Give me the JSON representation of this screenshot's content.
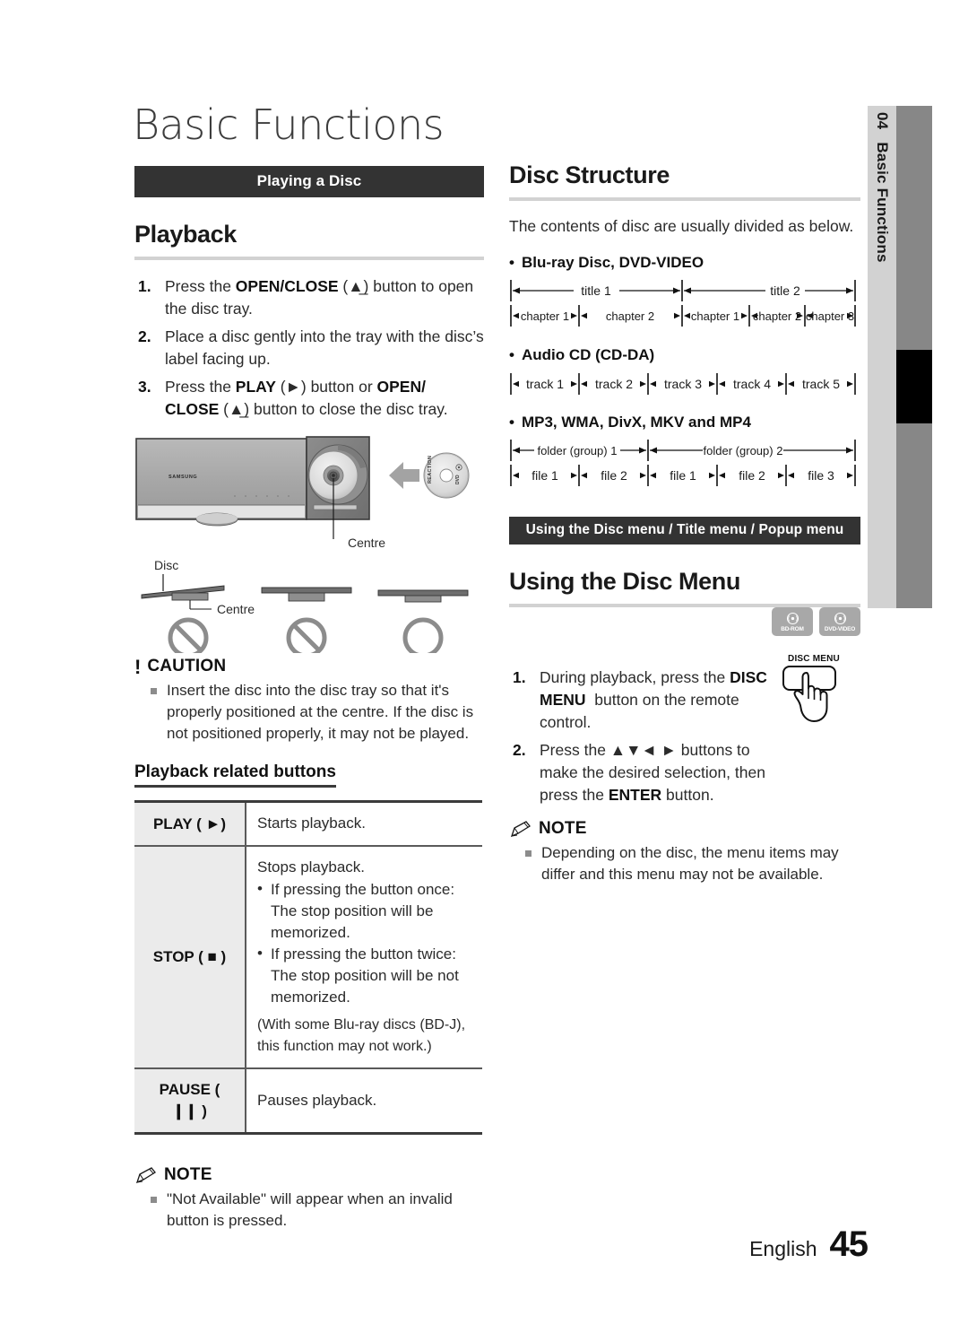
{
  "page": {
    "chapter_number": "04",
    "chapter_name": "Basic Functions",
    "title": "Basic Functions",
    "footer_language": "English",
    "footer_page": "45"
  },
  "left_column": {
    "banner": "Playing a Disc",
    "heading": "Playback",
    "steps": [
      {
        "num": "1.",
        "html": "Press the <b>OPEN/CLOSE</b> (&#9650;&#818;) button to open the disc tray."
      },
      {
        "num": "2.",
        "html": "Place a disc gently into the tray with the disc’s label facing up."
      },
      {
        "num": "3.",
        "html": "Press the <b>PLAY</b> (&#9658;) button or <b>OPEN/ CLOSE</b> (&#9650;&#818;) button to close the disc tray."
      }
    ],
    "illustration": {
      "brand_label": "SAMSUNG",
      "disc_label": "REACTION",
      "disc_format_label": "DVD",
      "callout_centre_top": "Centre",
      "callout_disc": "Disc",
      "callout_centre_bottom": "Centre"
    },
    "caution": {
      "glyph": "!",
      "word": "CAUTION",
      "items": [
        "Insert the disc into the disc tray so that it's properly positioned at the centre. If the disc is not positioned properly, it may not be played."
      ]
    },
    "subheading": "Playback related buttons",
    "table": {
      "rows": [
        {
          "key_html": "PLAY ( &#9658;)",
          "lead": "Starts playback.",
          "bullets": [],
          "paren": ""
        },
        {
          "key_html": "STOP ( &#9632; )",
          "lead": "Stops playback.",
          "bullets": [
            "If pressing the button once: The stop position will be memorized.",
            "If pressing the button twice: The stop position will be not memorized."
          ],
          "paren": "(With some Blu-ray discs (BD-J), this function may not work.)"
        },
        {
          "key_html": "PAUSE ( &#10073;&#10073; )",
          "lead": "Pauses playback.",
          "bullets": [],
          "paren": ""
        }
      ]
    },
    "note": {
      "word": "NOTE",
      "items": [
        "\"Not Available\" will appear when an invalid button is pressed."
      ]
    }
  },
  "right_column": {
    "heading": "Disc Structure",
    "intro": "The contents of disc are usually divided as below.",
    "diagrams": [
      {
        "label": "Blu-ray Disc, DVD-VIDEO",
        "top_row": [
          "title 1",
          "title 2"
        ],
        "bottom_row": [
          "chapter 1",
          "chapter 2",
          "chapter 1",
          "chapter 2",
          "chapter 3"
        ]
      },
      {
        "label": "Audio CD (CD-DA)",
        "top_row": [],
        "bottom_row": [
          "track 1",
          "track 2",
          "track 3",
          "track 4",
          "track 5"
        ]
      },
      {
        "label": "MP3, WMA, DivX, MKV and MP4",
        "top_row": [
          "folder (group) 1",
          "folder (group) 2"
        ],
        "bottom_row": [
          "file 1",
          "file 2",
          "file 1",
          "file 2",
          "file 3"
        ]
      }
    ],
    "banner": "Using the Disc menu / Title menu / Popup menu",
    "menu_heading": "Using the Disc Menu",
    "badges": [
      {
        "label": "BD-ROM"
      },
      {
        "label": "DVD-VIDEO"
      }
    ],
    "hand_caption": "DISC MENU",
    "steps": [
      {
        "num": "1.",
        "html": "During playback, press the <b>DISC MENU</b>&nbsp; button on the remote control."
      },
      {
        "num": "2.",
        "html": "Press the &#9650;&#9660;&#9668; &#9658; buttons to make the desired selection, then press the <b>ENTER</b> button."
      }
    ],
    "note": {
      "word": "NOTE",
      "items": [
        "Depending on the disc, the menu items may differ and this menu may not be available."
      ]
    }
  },
  "colors": {
    "banner_bg": "#333333",
    "rule": "#d2d2d2",
    "tab_inner": "#d2d2d2",
    "tab_outer": "#878787",
    "table_key_bg": "#ebebeb",
    "bullet": "#8c8c8c"
  }
}
